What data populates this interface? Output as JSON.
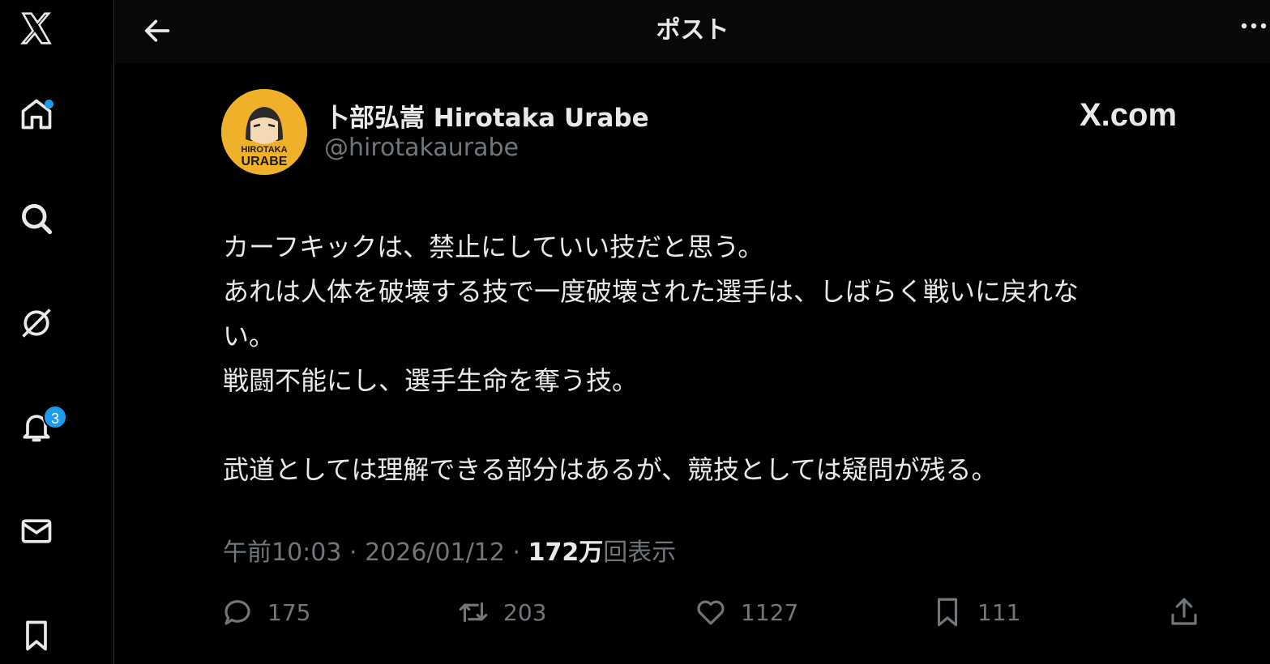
{
  "header": {
    "title": "ポスト"
  },
  "sidebar": {
    "notification_count": "3"
  },
  "author": {
    "name": "卜部弘嵩 Hirotaka Urabe",
    "handle": "@hirotakaurabe",
    "avatar_text_1": "HIROTAKA",
    "avatar_text_2": "URABE"
  },
  "brand": "X.com",
  "post": {
    "lines": [
      "カーフキックは、禁止にしていい技だと思う。",
      "あれは人体を破壊する技で一度破壊された選手は、しばらく戦いに戻れな",
      "い。",
      "戦闘不能にし、選手生命を奪う技。",
      "武道としては理解できる部分はあるが、競技としては疑問が残る。"
    ],
    "time": "午前10:03 · 2026/01/12 · ",
    "views_count": "172万",
    "views_label": "回表示"
  },
  "actions": {
    "replies": "175",
    "reposts": "203",
    "likes": "1127",
    "bookmarks": "111"
  },
  "colors": {
    "accent": "#1d9bf0",
    "background": "#000000",
    "muted": "#71767b",
    "avatar_bg": "#f0b12a"
  }
}
